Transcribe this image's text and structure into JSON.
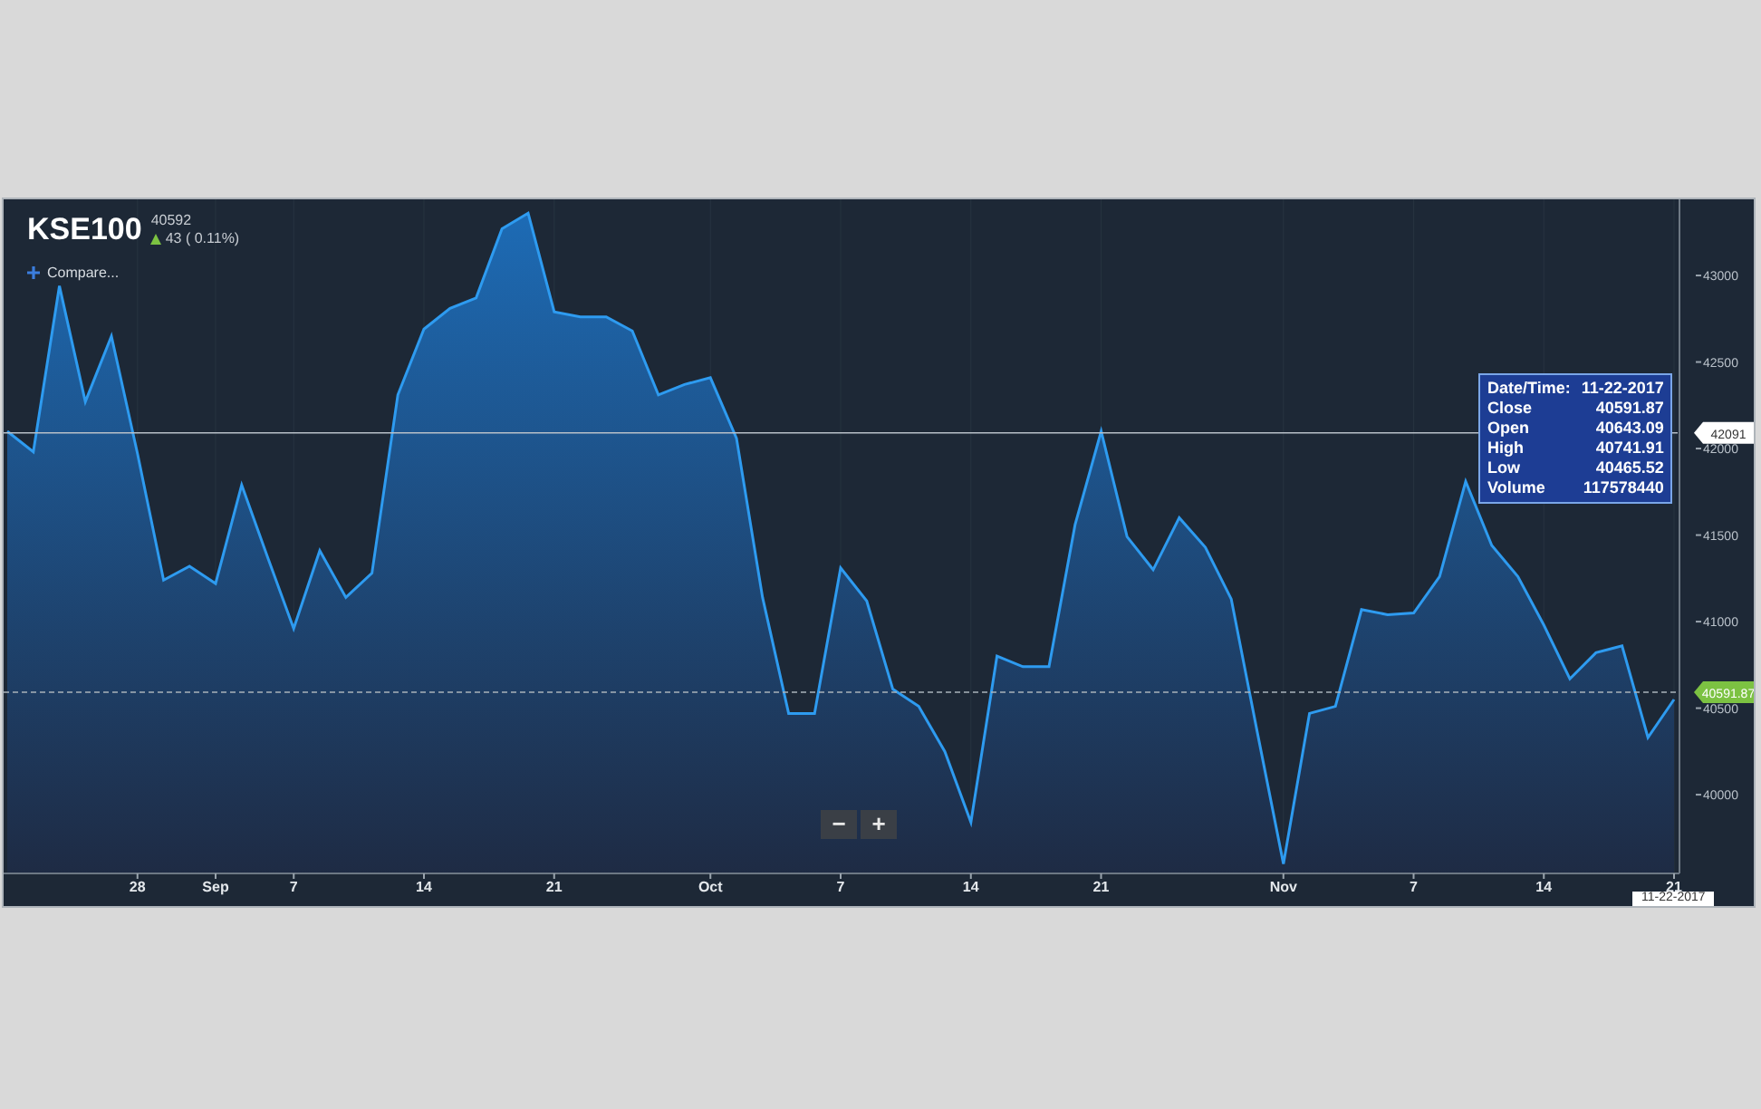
{
  "header": {
    "symbol": "KSE100",
    "price": "40592",
    "change": "43 ( 0.11%)",
    "rising": true,
    "compare": "Compare..."
  },
  "tooltip": {
    "rows": [
      {
        "label": "Date/Time:",
        "value": "11-22-2017"
      },
      {
        "label": "Close",
        "value": "40591.87"
      },
      {
        "label": "Open",
        "value": "40643.09"
      },
      {
        "label": "High",
        "value": "40741.91"
      },
      {
        "label": "Low",
        "value": "40465.52"
      },
      {
        "label": "Volume",
        "value": "117578440"
      }
    ]
  },
  "zoom_buttons": [
    "−",
    "+"
  ],
  "cursor_date": "11-22-2017",
  "chart_data": {
    "type": "area",
    "categories": [
      null,
      null,
      null,
      null,
      null,
      "28",
      null,
      null,
      "Sep",
      null,
      null,
      "7",
      null,
      null,
      null,
      null,
      "14",
      null,
      null,
      null,
      null,
      "21",
      null,
      null,
      null,
      null,
      null,
      "Oct",
      null,
      null,
      null,
      null,
      "7",
      null,
      null,
      null,
      null,
      "14",
      null,
      null,
      null,
      null,
      "21",
      null,
      null,
      null,
      null,
      null,
      null,
      "Nov",
      null,
      null,
      null,
      null,
      "7",
      null,
      null,
      null,
      null,
      "14",
      null,
      null,
      null,
      null,
      "21"
    ],
    "series": [
      {
        "color": "#2e9bf0",
        "values": [
          42100,
          41980,
          42940,
          42270,
          42650,
          41970,
          41240,
          41320,
          41220,
          41790,
          41370,
          40960,
          41410,
          41140,
          41280,
          42310,
          42690,
          42810,
          42870,
          43270,
          43360,
          42790,
          42760,
          42760,
          42680,
          42310,
          42370,
          42410,
          42060,
          41140,
          40470,
          40470,
          41310,
          41120,
          40610,
          40510,
          40250,
          39840,
          40800,
          40740,
          40740,
          41560,
          42100,
          41490,
          41300,
          41600,
          41430,
          41130,
          40360,
          39600,
          40470,
          40510,
          41070,
          41040,
          41050,
          41260,
          41810,
          41440,
          41260,
          40980,
          40670,
          40820,
          40860,
          40330,
          40550
        ]
      }
    ],
    "ylim": [
      39545,
      43440
    ],
    "yticks": [
      40000,
      40500,
      41000,
      41500,
      42000,
      42500,
      43000
    ],
    "grid": true
  },
  "price_markers": [
    {
      "kind": "crosshair",
      "label": "42091"
    },
    {
      "kind": "last",
      "label": "40591.87"
    }
  ]
}
